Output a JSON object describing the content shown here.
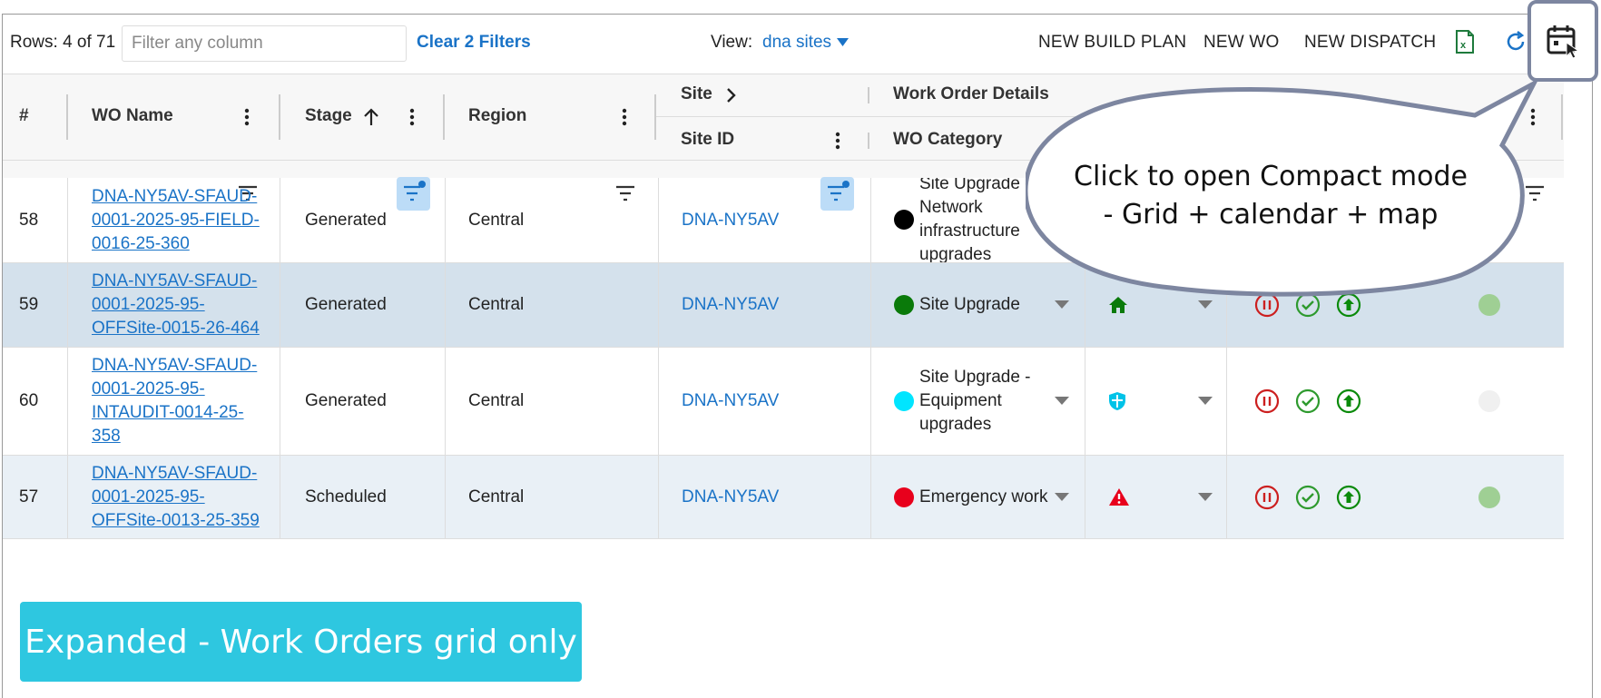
{
  "toolbar": {
    "rows_label": "Rows: 4 of 71",
    "filter_placeholder": "Filter any column",
    "clear_filters": "Clear 2 Filters",
    "view_label": "View:",
    "view_value": "dna sites",
    "new_build_plan": "NEW BUILD PLAN",
    "new_wo": "NEW WO",
    "new_dispatch": "NEW DISPATCH",
    "icons": [
      "excel-icon",
      "refresh-icon",
      "calendar-cursor-icon"
    ]
  },
  "header": {
    "num": "#",
    "wo_name": "WO Name",
    "stage": "Stage",
    "region": "Region",
    "site_group": "Site",
    "site_id": "Site ID",
    "wo_details_group": "Work Order Details",
    "wo_category": "WO Category",
    "stage_sort": "ascending"
  },
  "rows": [
    {
      "num": "58",
      "wo_name": "DNA-NY5AV-SFAUD-\n0001-2025-95-FIELD-\n0016-25-360",
      "stage": "Generated",
      "region": "Central",
      "site_id": "DNA-NY5AV",
      "category": "Site Upgrade -\nNetwork\ninfrastructure\nupgrades",
      "category_color": "#000000",
      "type_icon": "",
      "status_color": ""
    },
    {
      "num": "59",
      "wo_name": "DNA-NY5AV-SFAUD-\n0001-2025-95-\nOFFSite-0015-26-464",
      "stage": "Generated",
      "region": "Central",
      "site_id": "DNA-NY5AV",
      "category": "Site Upgrade",
      "category_color": "#0a7a0a",
      "type_icon": "home-icon",
      "status_color": "#9fcf94"
    },
    {
      "num": "60",
      "wo_name": "DNA-NY5AV-SFAUD-\n0001-2025-95-\nINTAUDIT-0014-25-\n358",
      "stage": "Generated",
      "region": "Central",
      "site_id": "DNA-NY5AV",
      "category": "Site Upgrade -\nEquipment\nupgrades",
      "category_color": "#00e5ff",
      "type_icon": "shield-icon",
      "status_color": "#f0f0f0"
    },
    {
      "num": "57",
      "wo_name": "DNA-NY5AV-SFAUD-\n0001-2025-95-\nOFFSite-0013-25-359",
      "stage": "Scheduled",
      "region": "Central",
      "site_id": "DNA-NY5AV",
      "category": "Emergency work",
      "category_color": "#e8001c",
      "type_icon": "warning-icon",
      "status_color": "#9fcf94"
    }
  ],
  "callout": {
    "line1": "Click to open Compact mode",
    "line2": "- Grid + calendar + map"
  },
  "banner": "Expanded - Work Orders grid only",
  "colors": {
    "link": "#1a73c7",
    "row_shaded": "#d4e1ec",
    "banner": "#2ec7e0",
    "pause": "#cc1f1f",
    "check": "#2e9a2e",
    "upload": "#0a8a0a"
  }
}
